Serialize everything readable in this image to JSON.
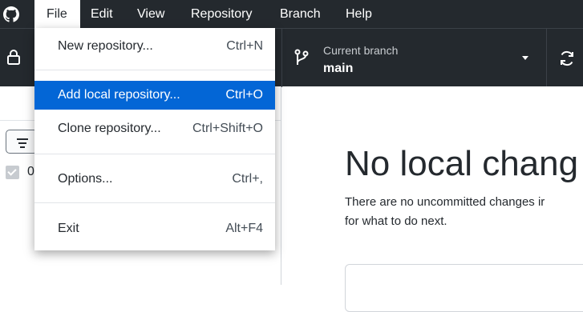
{
  "menubar": {
    "items": [
      {
        "label": "File"
      },
      {
        "label": "Edit"
      },
      {
        "label": "View"
      },
      {
        "label": "Repository"
      },
      {
        "label": "Branch"
      },
      {
        "label": "Help"
      }
    ]
  },
  "toolbar": {
    "branch_caption": "Current branch",
    "branch_name": "main"
  },
  "file_menu": {
    "items": [
      {
        "label": "New repository...",
        "shortcut": "Ctrl+N"
      },
      {
        "label": "Add local repository...",
        "shortcut": "Ctrl+O"
      },
      {
        "label": "Clone repository...",
        "shortcut": "Ctrl+Shift+O"
      },
      {
        "label": "Options...",
        "shortcut": "Ctrl+,"
      },
      {
        "label": "Exit",
        "shortcut": "Alt+F4"
      }
    ]
  },
  "sidebar": {
    "changed_count": "0"
  },
  "main": {
    "title": "No local chang",
    "desc_line1": "There are no uncommitted changes ir",
    "desc_line2": "for what to do next."
  },
  "colors": {
    "titlebar": "#24292e",
    "selected": "#0366d6"
  }
}
